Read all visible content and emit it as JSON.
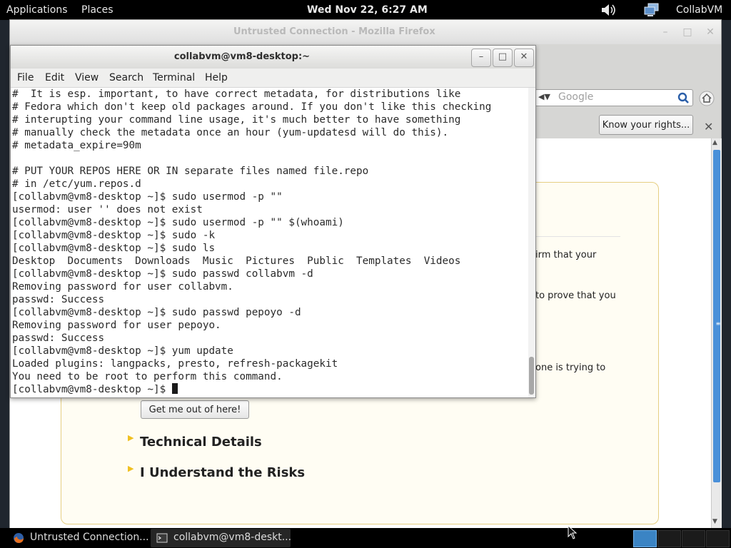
{
  "top_panel": {
    "applications": "Applications",
    "places": "Places",
    "clock": "Wed Nov 22,  6:27 AM",
    "user": "CollabVM",
    "volume_icon": "speaker-icon",
    "network_icon": "network-icon"
  },
  "firefox": {
    "title": "Untrusted Connection - Mozilla Firefox",
    "search_placeholder": "Google",
    "know_rights": "Know your rights...",
    "error_snippets": [
      "irm that your",
      "to prove that you",
      "one is trying to"
    ],
    "get_out_button": "Get me out of here!",
    "technical_details": "Technical Details",
    "understand_risks": "I Understand the Risks"
  },
  "terminal": {
    "title": "collabvm@vm8-desktop:~",
    "menu": [
      "File",
      "Edit",
      "View",
      "Search",
      "Terminal",
      "Help"
    ],
    "lines": [
      "#  It is esp. important, to have correct metadata, for distributions like",
      "# Fedora which don't keep old packages around. If you don't like this checking",
      "# interupting your command line usage, it's much better to have something",
      "# manually check the metadata once an hour (yum-updatesd will do this).",
      "# metadata_expire=90m",
      "",
      "# PUT YOUR REPOS HERE OR IN separate files named file.repo",
      "# in /etc/yum.repos.d",
      "[collabvm@vm8-desktop ~]$ sudo usermod -p \"\"",
      "usermod: user '' does not exist",
      "[collabvm@vm8-desktop ~]$ sudo usermod -p \"\" $(whoami)",
      "[collabvm@vm8-desktop ~]$ sudo -k",
      "[collabvm@vm8-desktop ~]$ sudo ls",
      "Desktop  Documents  Downloads  Music  Pictures  Public  Templates  Videos",
      "[collabvm@vm8-desktop ~]$ sudo passwd collabvm -d",
      "Removing password for user collabvm.",
      "passwd: Success",
      "[collabvm@vm8-desktop ~]$ sudo passwd pepoyo -d",
      "Removing password for user pepoyo.",
      "passwd: Success",
      "[collabvm@vm8-desktop ~]$ yum update",
      "Loaded plugins: langpacks, presto, refresh-packagekit",
      "You need to be root to perform this command.",
      "[collabvm@vm8-desktop ~]$ "
    ]
  },
  "taskbar": {
    "firefox_task": "Untrusted Connection...",
    "terminal_task": "collabvm@vm8-deskt...",
    "workspace_count": 4
  },
  "colors": {
    "panel": "#000000",
    "workspace_active": "#3b84c4",
    "error_border": "#e6cf83",
    "scroll_thumb": "#4a90d9"
  }
}
